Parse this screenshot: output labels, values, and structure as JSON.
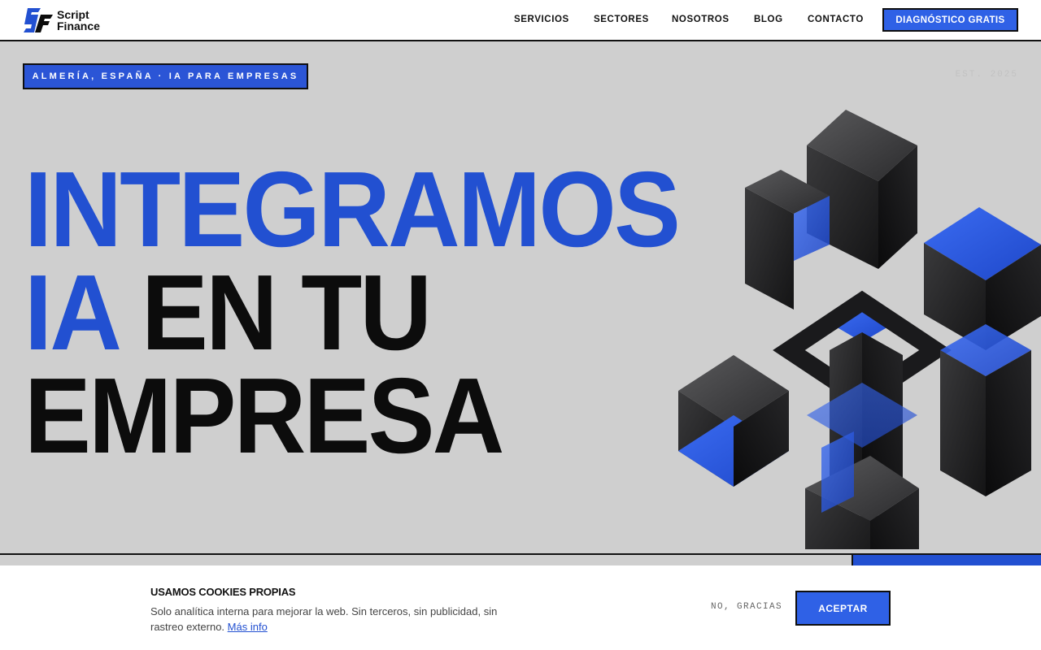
{
  "header": {
    "logo": {
      "line1": "Script",
      "line2": "Finance",
      "mark_text": "SF"
    },
    "nav": [
      {
        "label": "SERVICIOS"
      },
      {
        "label": "SECTORES"
      },
      {
        "label": "NOSOTROS"
      },
      {
        "label": "BLOG"
      },
      {
        "label": "CONTACTO"
      }
    ],
    "cta_label": "DIAGNÓSTICO GRATIS"
  },
  "hero": {
    "tag": "ALMERÍA, ESPAÑA · IA PARA EMPRESAS",
    "est": "EST. 2025",
    "headline": {
      "line1": "INTEGRAMOS",
      "line2_blue": "IA",
      "line2_black": " EN TU",
      "line3": "EMPRESA"
    },
    "image": "abstract-3d-lattice-sculpture"
  },
  "progress": {
    "fraction": 0.18
  },
  "cookie": {
    "title": "USAMOS COOKIES PROPIAS",
    "text": "Solo analítica interna para mejorar la web. Sin terceros, sin publicidad, sin rastreo externo.",
    "link": "Más info",
    "decline": "NO, GRACIAS",
    "accept": "ACEPTAR"
  },
  "colors": {
    "accent": "#2f61e6",
    "headline_blue": "#2250d1",
    "background": "#cfcfcf",
    "ink": "#0c0c0c"
  }
}
